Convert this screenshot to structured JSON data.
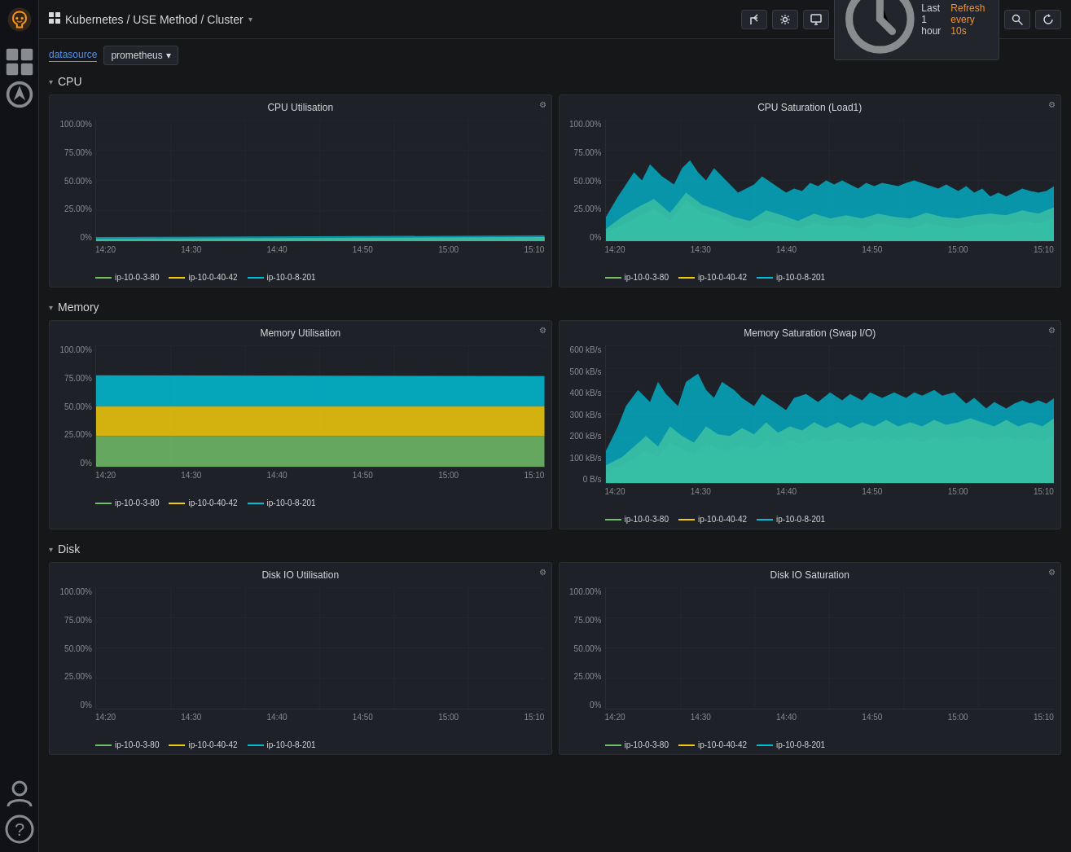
{
  "sidebar": {
    "logo_alt": "Grafana",
    "items": [
      {
        "name": "home",
        "icon": "⌂"
      },
      {
        "name": "dashboards",
        "icon": "▦"
      },
      {
        "name": "explore",
        "icon": "🧭"
      }
    ],
    "bottom_items": [
      {
        "name": "profile",
        "icon": "👤"
      },
      {
        "name": "help",
        "icon": "?"
      }
    ]
  },
  "topbar": {
    "title": "Kubernetes / USE Method / Cluster",
    "share_icon": "↗",
    "settings_icon": "⚙",
    "display_icon": "🖥",
    "time_range": "Last 1 hour",
    "refresh": "Refresh every 10s",
    "search_icon": "🔍",
    "sync_icon": "↺"
  },
  "filter_bar": {
    "label": "datasource",
    "datasource": "prometheus",
    "dropdown_icon": "▾"
  },
  "sections": [
    {
      "id": "cpu",
      "title": "CPU",
      "panels": [
        {
          "id": "cpu-utilisation",
          "title": "CPU Utilisation",
          "y_labels": [
            "100.00%",
            "75.00%",
            "50.00%",
            "25.00%",
            "0%"
          ],
          "x_labels": [
            "14:20",
            "14:30",
            "14:40",
            "14:50",
            "15:00",
            "15:10"
          ],
          "chart_type": "area_flat",
          "colors": [
            "#73bf69",
            "#f2cc0c",
            "#00bcd4"
          ]
        },
        {
          "id": "cpu-saturation",
          "title": "CPU Saturation (Load1)",
          "y_labels": [
            "100.00%",
            "75.00%",
            "50.00%",
            "25.00%",
            "0%"
          ],
          "x_labels": [
            "14:20",
            "14:30",
            "14:40",
            "14:50",
            "15:00",
            "15:10"
          ],
          "chart_type": "area_spiky",
          "colors": [
            "#73bf69",
            "#f2cc0c",
            "#00bcd4"
          ]
        }
      ],
      "legend": [
        "ip-10-0-3-80",
        "ip-10-0-40-42",
        "ip-10-0-8-201"
      ]
    },
    {
      "id": "memory",
      "title": "Memory",
      "panels": [
        {
          "id": "memory-utilisation",
          "title": "Memory Utilisation",
          "y_labels": [
            "100.00%",
            "75.00%",
            "50.00%",
            "25.00%",
            "0%"
          ],
          "x_labels": [
            "14:20",
            "14:30",
            "14:40",
            "14:50",
            "15:00",
            "15:10"
          ],
          "chart_type": "area_memory",
          "colors": [
            "#73bf69",
            "#f2cc0c",
            "#00bcd4"
          ]
        },
        {
          "id": "memory-saturation",
          "title": "Memory Saturation (Swap I/O)",
          "y_labels": [
            "600 kB/s",
            "500 kB/s",
            "400 kB/s",
            "300 kB/s",
            "200 kB/s",
            "100 kB/s",
            "0 B/s"
          ],
          "x_labels": [
            "14:20",
            "14:30",
            "14:40",
            "14:50",
            "15:00",
            "15:10"
          ],
          "chart_type": "area_swap",
          "colors": [
            "#73bf69",
            "#f2cc0c",
            "#00bcd4"
          ]
        }
      ],
      "legend": [
        "ip-10-0-3-80",
        "ip-10-0-40-42",
        "ip-10-0-8-201"
      ]
    },
    {
      "id": "disk",
      "title": "Disk",
      "panels": [
        {
          "id": "disk-io-utilisation",
          "title": "Disk IO Utilisation",
          "y_labels": [
            "100.00%",
            "75.00%",
            "50.00%",
            "25.00%",
            "0%"
          ],
          "x_labels": [
            "14:20",
            "14:30",
            "14:40",
            "14:50",
            "15:00",
            "15:10"
          ],
          "chart_type": "area_flat",
          "colors": [
            "#73bf69",
            "#f2cc0c",
            "#00bcd4"
          ]
        },
        {
          "id": "disk-io-saturation",
          "title": "Disk IO Saturation",
          "y_labels": [
            "100.00%",
            "75.00%",
            "50.00%",
            "25.00%",
            "0%"
          ],
          "x_labels": [
            "14:20",
            "14:30",
            "14:40",
            "14:50",
            "15:00",
            "15:10"
          ],
          "chart_type": "area_flat",
          "colors": [
            "#73bf69",
            "#f2cc0c",
            "#00bcd4"
          ]
        }
      ],
      "legend": [
        "ip-10-0-3-80",
        "ip-10-0-40-42",
        "ip-10-0-8-201"
      ]
    }
  ]
}
